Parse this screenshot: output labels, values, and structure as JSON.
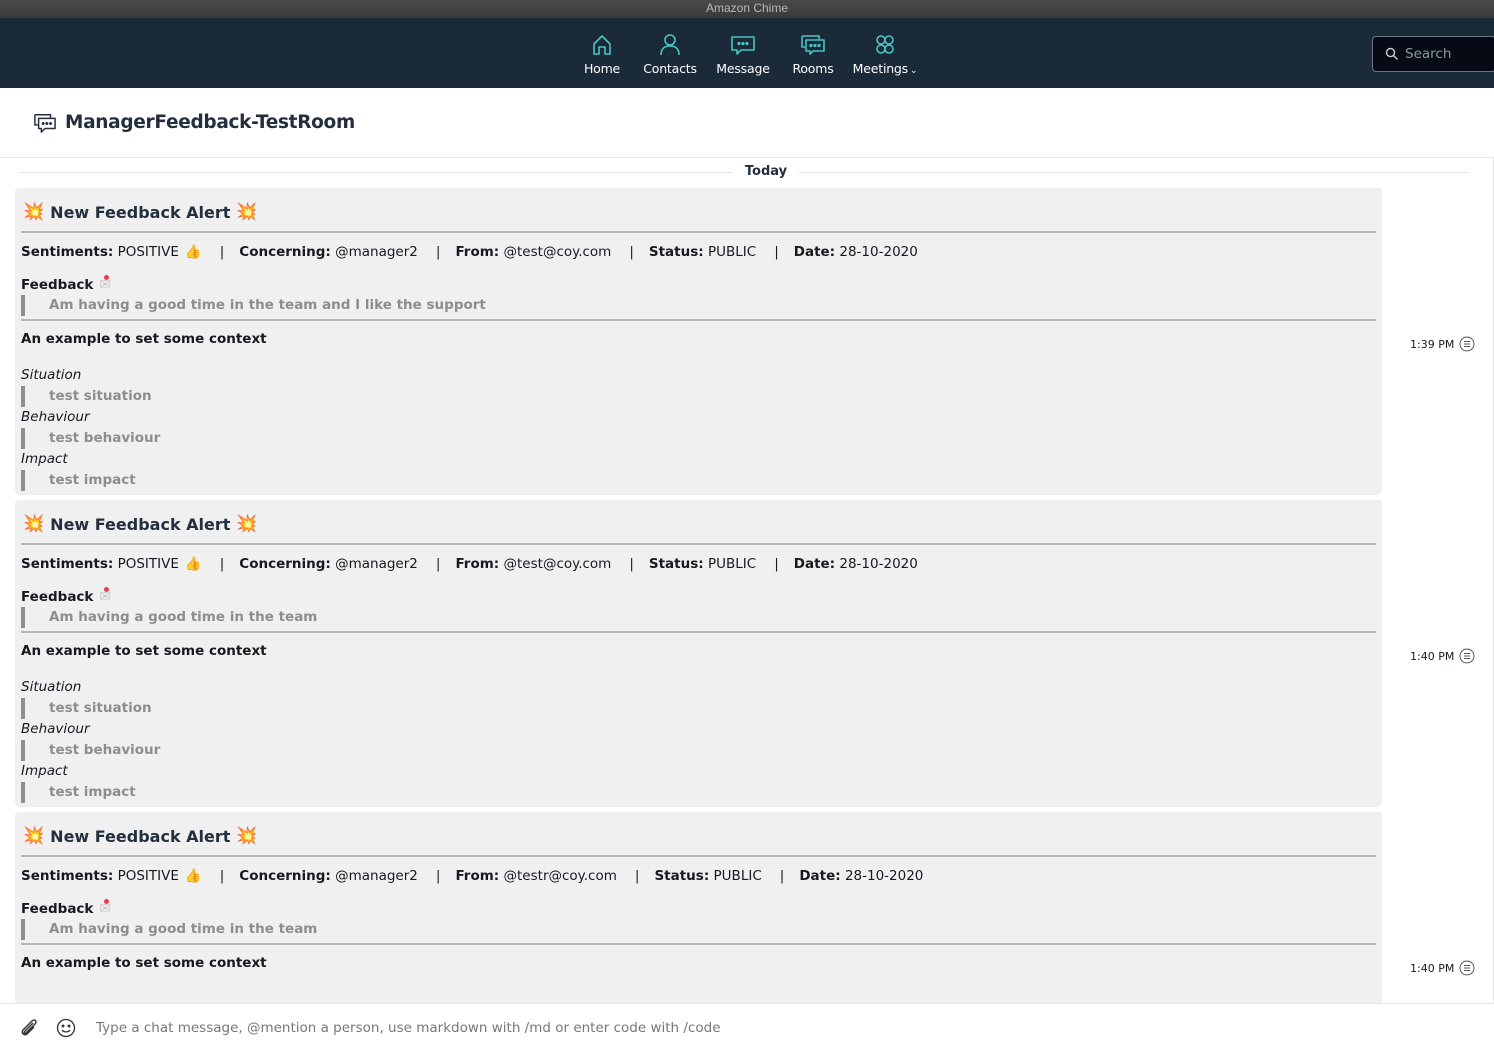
{
  "window": {
    "title": "Amazon Chime"
  },
  "nav": {
    "items": [
      {
        "label": "Home",
        "icon": "home-icon"
      },
      {
        "label": "Contacts",
        "icon": "person-icon"
      },
      {
        "label": "Message",
        "icon": "message-icon"
      },
      {
        "label": "Rooms",
        "icon": "rooms-icon"
      },
      {
        "label": "Meetings",
        "icon": "meetings-icon",
        "dropdown": true
      }
    ],
    "accent": "#4bc4c4",
    "search": {
      "placeholder": "Search",
      "value": ""
    }
  },
  "room": {
    "title": "ManagerFeedback-TestRoom"
  },
  "chat": {
    "day_label": "Today",
    "messages": [
      {
        "time": "1:39 PM",
        "title": "New Feedback Alert",
        "sentiments_label": "Sentiments:",
        "sentiments": "POSITIVE",
        "concerning_label": "Concerning:",
        "concerning": "@manager2",
        "from_label": "From:",
        "from": "@test@coy.com",
        "status_label": "Status:",
        "status": "PUBLIC",
        "date_label": "Date:",
        "date": "28-10-2020",
        "feedback_label": "Feedback",
        "feedback": "Am having a good time in the team and I like the support",
        "context_label": "An example to set some context",
        "situation_label": "Situation",
        "situation": "test situation",
        "behaviour_label": "Behaviour",
        "behaviour": "test behaviour",
        "impact_label": "Impact",
        "impact": "test impact"
      },
      {
        "time": "1:40 PM",
        "title": "New Feedback Alert",
        "sentiments_label": "Sentiments:",
        "sentiments": "POSITIVE",
        "concerning_label": "Concerning:",
        "concerning": "@manager2",
        "from_label": "From:",
        "from": "@test@coy.com",
        "status_label": "Status:",
        "status": "PUBLIC",
        "date_label": "Date:",
        "date": "28-10-2020",
        "feedback_label": "Feedback",
        "feedback": "Am having a good time in the team",
        "context_label": "An example to set some context",
        "situation_label": "Situation",
        "situation": "test situation",
        "behaviour_label": "Behaviour",
        "behaviour": "test behaviour",
        "impact_label": "Impact",
        "impact": "test impact"
      },
      {
        "time": "1:40 PM",
        "title": "New Feedback Alert",
        "sentiments_label": "Sentiments:",
        "sentiments": "POSITIVE",
        "concerning_label": "Concerning:",
        "concerning": "@manager2",
        "from_label": "From:",
        "from": "@testr@coy.com",
        "status_label": "Status:",
        "status": "PUBLIC",
        "date_label": "Date:",
        "date": "28-10-2020",
        "feedback_label": "Feedback",
        "feedback": "Am having a good time in the team",
        "context_label": "An example to set some context"
      }
    ]
  },
  "composer": {
    "placeholder": "Type a chat message, @mention a person, use markdown with /md or enter code with /code",
    "value": ""
  }
}
